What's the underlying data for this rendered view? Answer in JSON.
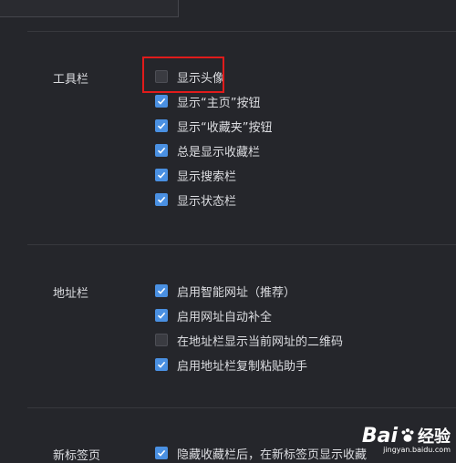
{
  "sections": {
    "toolbar": {
      "label": "工具栏",
      "options": [
        {
          "label": "显示头像",
          "checked": false
        },
        {
          "label": "显示“主页”按钮",
          "checked": true
        },
        {
          "label": "显示“收藏夹”按钮",
          "checked": true
        },
        {
          "label": "总是显示收藏栏",
          "checked": true
        },
        {
          "label": "显示搜索栏",
          "checked": true
        },
        {
          "label": "显示状态栏",
          "checked": true
        }
      ]
    },
    "address_bar": {
      "label": "地址栏",
      "options": [
        {
          "label": "启用智能网址（推荐）",
          "checked": true
        },
        {
          "label": "启用网址自动补全",
          "checked": true
        },
        {
          "label": "在地址栏显示当前网址的二维码",
          "checked": false
        },
        {
          "label": "启用地址栏复制粘贴助手",
          "checked": true
        }
      ]
    },
    "new_tab": {
      "label": "新标签页",
      "options": [
        {
          "label": "隐藏收藏栏后，在新标签页显示收藏",
          "checked": true
        }
      ]
    }
  },
  "watermark": {
    "brand": "Bai",
    "brand_suffix": "经验",
    "url": "jingyan.baidu.com"
  },
  "colors": {
    "background": "#25262b",
    "checkbox_on": "#4a90e2",
    "highlight": "#e01b1b"
  }
}
